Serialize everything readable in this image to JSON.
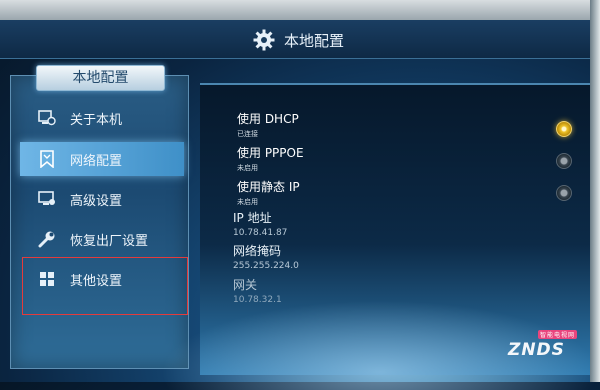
{
  "header": {
    "title": "本地配置",
    "icon": "gear-icon"
  },
  "sidebar": {
    "tab_label": "本地配置",
    "items": [
      {
        "label": "关于本机",
        "icon": "about-device-icon"
      },
      {
        "label": "网络配置",
        "icon": "network-icon",
        "selected": true
      },
      {
        "label": "高级设置",
        "icon": "advanced-settings-icon"
      },
      {
        "label": "恢复出厂设置",
        "icon": "wrench-icon"
      },
      {
        "label": "其他设置",
        "icon": "grid-icon"
      }
    ]
  },
  "network": {
    "options": [
      {
        "label": "使用 DHCP",
        "status": "已连接",
        "selected": true
      },
      {
        "label": "使用 PPPOE",
        "status": "未启用",
        "selected": false
      },
      {
        "label": "使用静态 IP",
        "status": "未启用",
        "selected": false
      }
    ],
    "info": [
      {
        "label": "IP 地址",
        "value": "10.78.41.87"
      },
      {
        "label": "网络掩码",
        "value": "255.255.224.0"
      },
      {
        "label": "网关",
        "value": "10.78.32.1"
      }
    ]
  },
  "watermark": {
    "text": "ZNDS",
    "tag": "智能电视网"
  },
  "colors": {
    "accent": "#4f9fd6",
    "radio_on": "#f1c52c",
    "highlight": "#e53b3b"
  }
}
